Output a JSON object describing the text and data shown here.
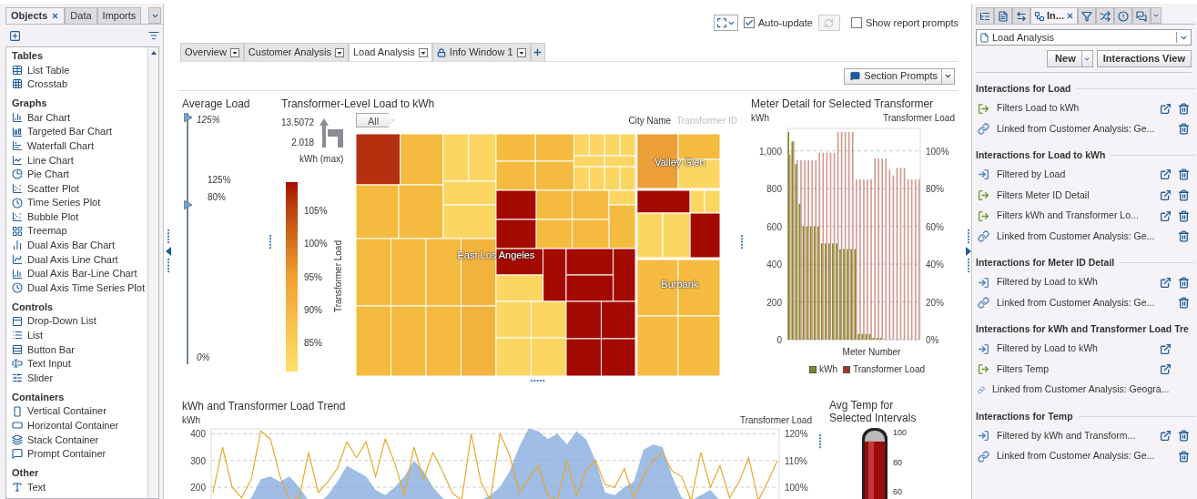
{
  "left_panel": {
    "tabs": [
      {
        "label": "Objects",
        "selected": true,
        "closable": true
      },
      {
        "label": "Data",
        "selected": false,
        "closable": false
      },
      {
        "label": "Imports",
        "selected": false,
        "closable": false
      }
    ],
    "sections": [
      {
        "title": "Tables",
        "items": [
          "List Table",
          "Crosstab"
        ]
      },
      {
        "title": "Graphs",
        "items": [
          "Bar Chart",
          "Targeted Bar Chart",
          "Waterfall Chart",
          "Line Chart",
          "Pie Chart",
          "Scatter Plot",
          "Time Series Plot",
          "Bubble Plot",
          "Treemap",
          "Dual Axis Bar Chart",
          "Dual Axis Line Chart",
          "Dual Axis Bar-Line Chart",
          "Dual Axis Time Series Plot"
        ]
      },
      {
        "title": "Controls",
        "items": [
          "Drop-Down List",
          "List",
          "Button Bar",
          "Text Input",
          "Slider"
        ]
      },
      {
        "title": "Containers",
        "items": [
          "Vertical Container",
          "Horizontal Container",
          "Stack Container",
          "Prompt Container"
        ]
      },
      {
        "title": "Other",
        "items": [
          "Text"
        ]
      }
    ]
  },
  "toolbar": {
    "auto_update": {
      "label": "Auto-update",
      "checked": true
    },
    "refresh": {
      "disabled": true
    },
    "show_prompts": {
      "label": "Show report prompts",
      "checked": false
    }
  },
  "report_tabs": [
    {
      "label": "Overview",
      "selected": false,
      "locked": false
    },
    {
      "label": "Customer Analysis",
      "selected": false,
      "locked": false
    },
    {
      "label": "Load Analysis",
      "selected": true,
      "locked": false
    },
    {
      "label": "Info Window 1",
      "selected": false,
      "locked": true
    }
  ],
  "section_prompts": {
    "label": "Section Prompts"
  },
  "average_load": {
    "title": "Average Load",
    "max_label": "125%",
    "min_label": "0%",
    "thumbs": [
      {
        "level": 1
      },
      {
        "level": 0.64
      }
    ],
    "range": [
      "125%",
      "80%"
    ]
  },
  "treemap": {
    "title": "Transformer-Level Load to kWh",
    "breadcrumb": "All",
    "hierarchy": [
      {
        "label": "City Name",
        "active": true
      },
      {
        "label": "Transformer ID",
        "active": false
      }
    ],
    "size_legend": {
      "max": "13.5072",
      "min": "2.018",
      "label": "kWh (max)"
    },
    "color_legend": {
      "title": "Transformer Load",
      "ticks": [
        "105%",
        "100%",
        "95%",
        "90%",
        "85%"
      ]
    },
    "regions": [
      {
        "label": "East Los Angeles"
      },
      {
        "label": "Valley Glen"
      },
      {
        "label": "Burbank"
      }
    ]
  },
  "meter_detail": {
    "title": "Meter Detail for Selected Transformer",
    "chart_data": {
      "type": "bar",
      "grid": true,
      "legend": true,
      "xlabel": "Meter Number",
      "ylabel": "kWh",
      "y2label": "Transformer Load",
      "ylim": [
        0,
        1100
      ],
      "yticks": [
        0,
        200,
        400,
        600,
        800,
        {
          "value": 1000,
          "label": "1,000"
        }
      ],
      "y2lim": [
        0,
        110
      ],
      "y2ticks": [
        {
          "value": 0,
          "label": "0%"
        },
        {
          "value": 20,
          "label": "20%"
        },
        {
          "value": 40,
          "label": "40%"
        },
        {
          "value": 60,
          "label": "60%"
        },
        {
          "value": 80,
          "label": "80%"
        },
        {
          "value": 100,
          "label": "100%"
        }
      ],
      "series": [
        {
          "name": "kWh",
          "color": "#7a8c1e",
          "axis": "y",
          "values": [
            1100,
            1050,
            930,
            720,
            600,
            600,
            600,
            600,
            600,
            510,
            510,
            510,
            510,
            510,
            480,
            480,
            480,
            480,
            480,
            30,
            30,
            30,
            30,
            10,
            10,
            10,
            0,
            0,
            0,
            0,
            0,
            0,
            0,
            0,
            0,
            0
          ]
        },
        {
          "name": "Transformer Load",
          "color": "#a8321f",
          "axis": "y2",
          "values": [
            98,
            105,
            95,
            95,
            95,
            95,
            95,
            95,
            99,
            99,
            99,
            99,
            99,
            110,
            110,
            110,
            110,
            110,
            85,
            85,
            85,
            85,
            85,
            96,
            96,
            96,
            96,
            90,
            87,
            91,
            91,
            91,
            85,
            85,
            85,
            85
          ]
        }
      ]
    }
  },
  "trend": {
    "title": "kWh and Transformer Load Trend",
    "chart_data": {
      "type": "line",
      "grid": true,
      "ylabel": "kWh",
      "y2label": "Transformer Load",
      "ylim": [
        125,
        425
      ],
      "yticks": [
        200,
        300,
        400
      ],
      "y2lim": [
        92.5,
        122.5
      ],
      "y2ticks": [
        {
          "value": 100,
          "label": "100%"
        },
        {
          "value": 110,
          "label": "110%"
        },
        {
          "value": 120,
          "label": "120%"
        }
      ],
      "series": [
        {
          "type": "area",
          "axis": "y2",
          "color": "#7fa7dc",
          "values": [
            93,
            93,
            93,
            94,
            96,
            103,
            104,
            102,
            104,
            100,
            95,
            94,
            97,
            102,
            108,
            106,
            104,
            99,
            97,
            100,
            104,
            110,
            106,
            100,
            96,
            94,
            93,
            93,
            95,
            97,
            100,
            106,
            115,
            122,
            121,
            118,
            120,
            116,
            121,
            118,
            110,
            98,
            97,
            100,
            102,
            114,
            116,
            115,
            104,
            96,
            95,
            97,
            99,
            95,
            94,
            93,
            93,
            93,
            94,
            93
          ]
        },
        {
          "type": "line",
          "axis": "y",
          "color": "#e8a92c",
          "values": [
            180,
            350,
            200,
            160,
            230,
            410,
            380,
            240,
            150,
            160,
            330,
            180,
            220,
            270,
            370,
            310,
            370,
            240,
            380,
            290,
            170,
            350,
            230,
            330,
            260,
            180,
            150,
            400,
            220,
            150,
            400,
            320,
            180,
            230,
            280,
            170,
            150,
            300,
            170,
            260,
            300,
            210,
            200,
            270,
            160,
            240,
            300,
            330,
            260,
            240,
            150,
            330,
            200,
            280,
            160,
            220,
            310,
            150,
            220,
            300
          ]
        }
      ]
    }
  },
  "temperature": {
    "title": "Avg Temp for Selected Intervals",
    "ticks": [
      "100",
      "80",
      "60"
    ]
  },
  "right_panel": {
    "tabs": [
      {
        "selected": false
      },
      {
        "selected": false
      },
      {
        "selected": false
      },
      {
        "label": "In...",
        "selected": true
      },
      {
        "selected": false
      },
      {
        "selected": false
      },
      {
        "selected": false
      },
      {
        "selected": false
      }
    ],
    "report": {
      "value": "Load Analysis"
    },
    "new_button": "New",
    "view_button": "Interactions View",
    "groups": [
      {
        "title": "Interactions for Load",
        "items": [
          {
            "kind": "filters",
            "text": "Filters Load to kWh",
            "editable": true,
            "deletable": true
          },
          {
            "kind": "linked",
            "text": "Linked from Customer Analysis: Ge...",
            "editable": false,
            "deletable": true
          }
        ]
      },
      {
        "title": "Interactions for Load to kWh",
        "items": [
          {
            "kind": "filtered",
            "text": "Filtered by Load",
            "editable": true,
            "deletable": true
          },
          {
            "kind": "filters",
            "text": "Filters Meter ID Detail",
            "editable": true,
            "deletable": true
          },
          {
            "kind": "filters",
            "text": "Filters kWh and Transformer Lo...",
            "editable": true,
            "deletable": true
          },
          {
            "kind": "linked",
            "text": "Linked from Customer Analysis: Ge...",
            "editable": false,
            "deletable": true
          }
        ]
      },
      {
        "title": "Interactions for Meter ID Detail",
        "items": [
          {
            "kind": "filtered",
            "text": "Filtered by Load to kWh",
            "editable": true,
            "deletable": true
          },
          {
            "kind": "linked",
            "text": "Linked from Customer Analysis: Ge...",
            "editable": false,
            "deletable": true
          }
        ]
      },
      {
        "title": "Interactions for kWh and Transformer Load Tre",
        "items": [
          {
            "kind": "filtered",
            "text": "Filtered by Load to kWh",
            "editable": true,
            "deletable": false
          },
          {
            "kind": "filters",
            "text": "Filters Temp",
            "editable": true,
            "deletable": false
          },
          {
            "kind": "linked",
            "text": "Linked from Customer Analysis: Geogra...",
            "editable": false,
            "deletable": false
          }
        ]
      },
      {
        "title": "Interactions for Temp",
        "items": [
          {
            "kind": "filtered",
            "text": "Filtered by kWh and Transform...",
            "editable": true,
            "deletable": true
          },
          {
            "kind": "linked",
            "text": "Linked from Customer Analysis: Ge...",
            "editable": false,
            "deletable": true
          }
        ]
      }
    ]
  }
}
